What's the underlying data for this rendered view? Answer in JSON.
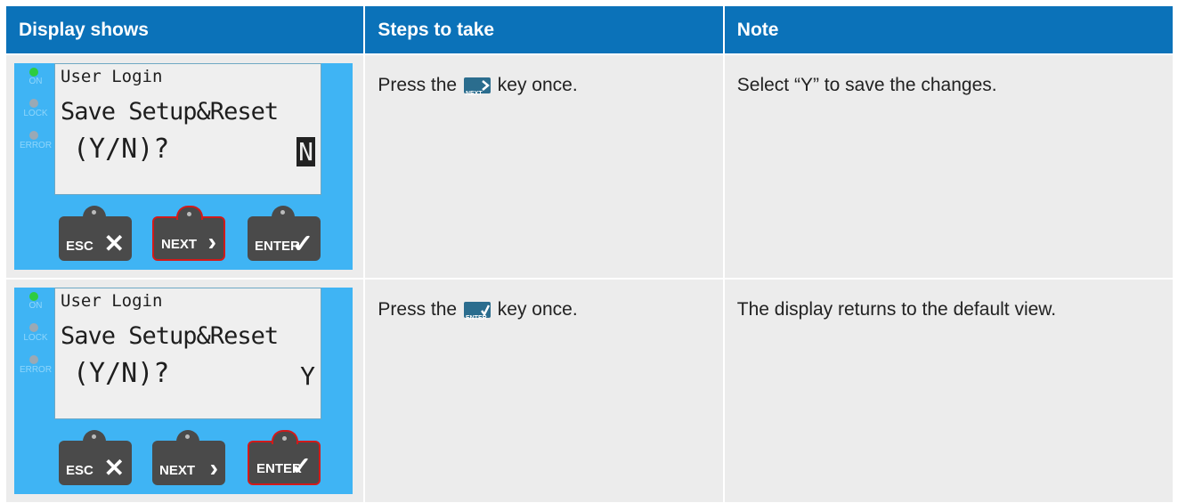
{
  "table": {
    "headers": [
      "Display shows",
      "Steps to take",
      "Note"
    ],
    "rows": [
      {
        "display": {
          "line1": "User Login",
          "line2": "Save Setup&Reset",
          "line3": "(Y/N)?",
          "value": "N",
          "value_highlighted": true,
          "leds": [
            "ON",
            "LOCK",
            "ERROR"
          ],
          "buttons": [
            "ESC",
            "NEXT",
            "ENTER"
          ],
          "active_button": "NEXT"
        },
        "step": {
          "before": "Press the",
          "key_label": "NEXT",
          "after": "key once."
        },
        "note": "Select “Y” to save the changes."
      },
      {
        "display": {
          "line1": "User Login",
          "line2": "Save Setup&Reset",
          "line3": "(Y/N)?",
          "value": "Y",
          "value_highlighted": false,
          "leds": [
            "ON",
            "LOCK",
            "ERROR"
          ],
          "buttons": [
            "ESC",
            "NEXT",
            "ENTER"
          ],
          "active_button": "ENTER"
        },
        "step": {
          "before": "Press the",
          "key_label": "ENTER",
          "after": "key once."
        },
        "note": "The display returns to the default view."
      }
    ]
  },
  "colors": {
    "header_bg": "#0b72b9",
    "panel_bg": "#3fb4f4",
    "led_on": "#2ecc40",
    "led_off": "#9aa9b5",
    "active_border": "#d11a1a"
  }
}
